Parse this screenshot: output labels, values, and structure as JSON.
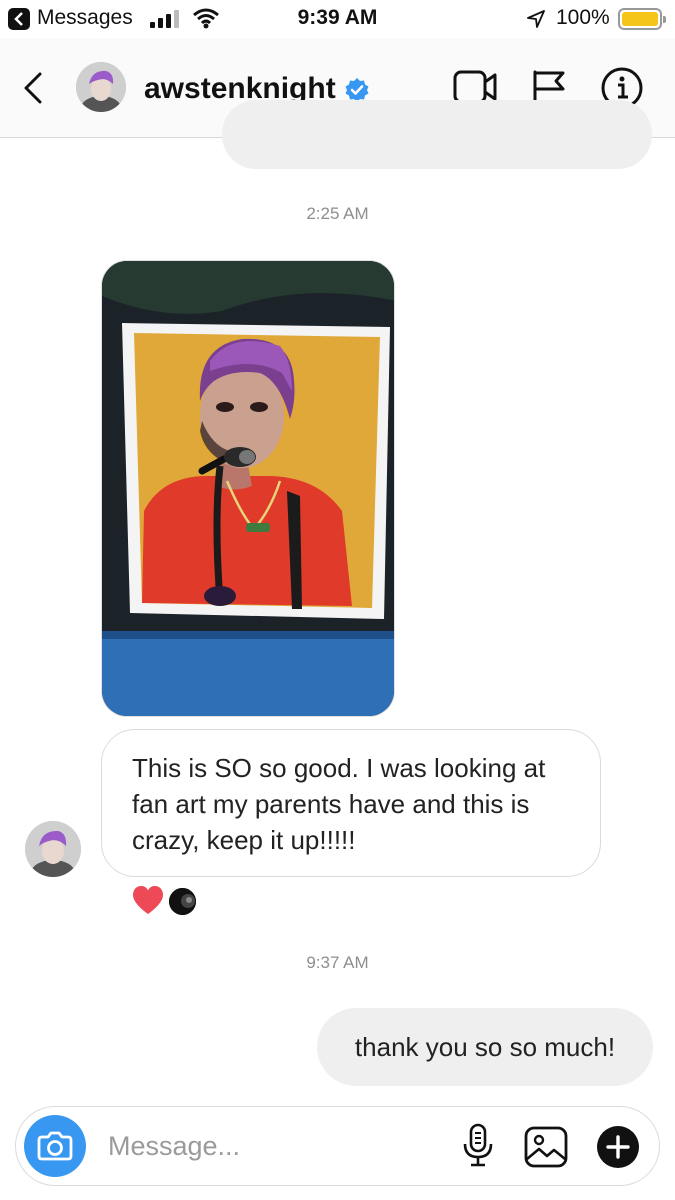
{
  "status_bar": {
    "back_app": "Messages",
    "time": "9:39 AM",
    "battery": "100%"
  },
  "header": {
    "username": "awstenknight",
    "verified": true
  },
  "thread": {
    "timestamp_1": "2:25 AM",
    "received_text": "This is SO so good. I was looking at fan art my parents have and this is crazy, keep it up!!!!!",
    "timestamp_2": "9:37 AM",
    "sent_text": "thank you so so much!"
  },
  "composer": {
    "placeholder": "Message..."
  },
  "colors": {
    "accent_blue": "#3897f0",
    "heart_red": "#ed4956",
    "bubble_gray": "#efefef"
  },
  "icons": [
    "back-chevron-icon",
    "verified-badge-icon",
    "video-call-icon",
    "flag-icon",
    "info-icon",
    "heart-icon",
    "camera-icon",
    "microphone-icon",
    "gallery-icon",
    "plus-icon"
  ]
}
